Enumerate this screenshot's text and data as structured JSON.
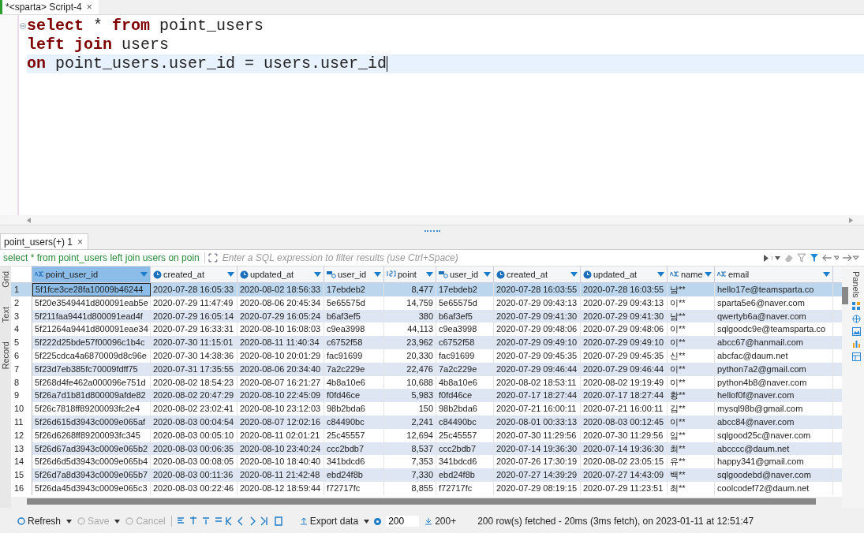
{
  "editor_tab": {
    "title": "*<sparta> Script-4",
    "close": "×"
  },
  "editor": {
    "lines": [
      {
        "current": false,
        "tokens": [
          {
            "kind": "keyword",
            "text": "select"
          },
          {
            "kind": "plain",
            "text": " * "
          },
          {
            "kind": "keyword",
            "text": "from"
          },
          {
            "kind": "plain",
            "text": " point_users"
          }
        ]
      },
      {
        "current": false,
        "tokens": [
          {
            "kind": "keyword",
            "text": "left"
          },
          {
            "kind": "keyword",
            "text": " join"
          },
          {
            "kind": "plain",
            "text": " users"
          }
        ]
      },
      {
        "current": true,
        "tokens": [
          {
            "kind": "keyword",
            "text": "on"
          },
          {
            "kind": "plain",
            "text": " point_users.user_id = users.user_id"
          }
        ]
      }
    ]
  },
  "results_tab": {
    "title": "point_users(+) 1",
    "close": "×"
  },
  "filter": {
    "query": "select * from point_users left join users on poin",
    "placeholder": "Enter a SQL expression to filter results (use Ctrl+Space)"
  },
  "side_tabs": [
    "Grid",
    "Text",
    "Record"
  ],
  "right_panel": {
    "label": "Panels"
  },
  "table": {
    "columns": [
      {
        "label": "point_user_id",
        "kind": "text",
        "selected": true
      },
      {
        "label": "created_at",
        "kind": "date",
        "selected": false
      },
      {
        "label": "updated_at",
        "kind": "date",
        "selected": false
      },
      {
        "label": "user_id",
        "kind": "key",
        "selected": false
      },
      {
        "label": "point",
        "kind": "number",
        "selected": false
      },
      {
        "label": "user_id",
        "kind": "key",
        "selected": false
      },
      {
        "label": "created_at",
        "kind": "date",
        "selected": false
      },
      {
        "label": "updated_at",
        "kind": "date",
        "selected": false
      },
      {
        "label": "name",
        "kind": "text",
        "selected": false
      },
      {
        "label": "email",
        "kind": "text",
        "selected": false
      }
    ],
    "rows": [
      {
        "number": "1",
        "selected": true,
        "cells": [
          "5f1fce3ce28fa10009b46244",
          "2020-07-28 16:05:33",
          "2020-08-02 18:56:33",
          "17ebdeb2",
          "8,477",
          "17ebdeb2",
          "2020-07-28 16:03:55",
          "2020-07-28 16:03:55",
          "남**",
          "hello17e@teamsparta.co"
        ]
      },
      {
        "number": "2",
        "selected": false,
        "cells": [
          "5f20e3549441d800091eab5e",
          "2020-07-29 11:47:49",
          "2020-08-06 20:45:34",
          "5e65575d",
          "14,759",
          "5e65575d",
          "2020-07-29 09:43:13",
          "2020-07-29 09:43:13",
          "이**",
          "sparta5e6@naver.com"
        ]
      },
      {
        "number": "3",
        "selected": false,
        "cells": [
          "5f211faa9441d800091ead4f",
          "2020-07-29 16:05:14",
          "2020-07-29 16:05:24",
          "b6af3ef5",
          "380",
          "b6af3ef5",
          "2020-07-29 09:41:30",
          "2020-07-29 09:41:30",
          "남**",
          "qwertyb6a@naver.com"
        ]
      },
      {
        "number": "4",
        "selected": false,
        "cells": [
          "5f21264a9441d800091eae34",
          "2020-07-29 16:33:31",
          "2020-08-10 16:08:03",
          "c9ea3998",
          "44,113",
          "c9ea3998",
          "2020-07-29 09:48:06",
          "2020-07-29 09:48:06",
          "이**",
          "sqlgoodc9e@teamsparta.co"
        ]
      },
      {
        "number": "5",
        "selected": false,
        "cells": [
          "5f222d25bde57f00096c1b4c",
          "2020-07-30 11:15:01",
          "2020-08-11 11:40:34",
          "c6752f58",
          "23,962",
          "c6752f58",
          "2020-07-29 09:49:10",
          "2020-07-29 09:49:10",
          "이**",
          "abcc67@hanmail.com"
        ]
      },
      {
        "number": "6",
        "selected": false,
        "cells": [
          "5f225cdca4a6870009d8c96e",
          "2020-07-30 14:38:36",
          "2020-08-10 20:01:29",
          "fac91699",
          "20,330",
          "fac91699",
          "2020-07-29 09:45:35",
          "2020-07-29 09:45:35",
          "신**",
          "abcfac@daum.net"
        ]
      },
      {
        "number": "7",
        "selected": false,
        "cells": [
          "5f23d7eb385fc70009fdff75",
          "2020-07-31 17:35:55",
          "2020-08-06 20:34:40",
          "7a2c229e",
          "22,476",
          "7a2c229e",
          "2020-07-29 09:46:44",
          "2020-07-29 09:46:44",
          "이**",
          "python7a2@gmail.com"
        ]
      },
      {
        "number": "8",
        "selected": false,
        "cells": [
          "5f268d4fe462a000096e751d",
          "2020-08-02 18:54:23",
          "2020-08-07 16:21:27",
          "4b8a10e6",
          "10,688",
          "4b8a10e6",
          "2020-08-02 18:53:11",
          "2020-08-02 19:19:49",
          "이**",
          "python4b8@naver.com"
        ]
      },
      {
        "number": "9",
        "selected": false,
        "cells": [
          "5f26a7d1b81d800009afde82",
          "2020-08-02 20:47:29",
          "2020-08-10 22:45:09",
          "f0fd46ce",
          "5,983",
          "f0fd46ce",
          "2020-07-17 18:27:44",
          "2020-07-17 18:27:44",
          "황**",
          "hellof0f@naver.com"
        ]
      },
      {
        "number": "10",
        "selected": false,
        "cells": [
          "5f26c7818ff89200093fc2e4",
          "2020-08-02 23:02:41",
          "2020-08-10 23:12:03",
          "98b2bda6",
          "150",
          "98b2bda6",
          "2020-07-21 16:00:11",
          "2020-07-21 16:00:11",
          "김**",
          "mysql98b@gmail.com"
        ]
      },
      {
        "number": "11",
        "selected": false,
        "cells": [
          "5f26d615d3943c0009e065af",
          "2020-08-03 00:04:54",
          "2020-08-07 12:02:16",
          "c84490bc",
          "2,241",
          "c84490bc",
          "2020-08-01 00:33:13",
          "2020-08-03 00:12:45",
          "이**",
          "abcc84@naver.com"
        ]
      },
      {
        "number": "12",
        "selected": false,
        "cells": [
          "5f26d6268ff89200093fc345",
          "2020-08-03 00:05:10",
          "2020-08-11 02:01:21",
          "25c45557",
          "12,694",
          "25c45557",
          "2020-07-30 11:29:56",
          "2020-07-30 11:29:56",
          "임**",
          "sqlgood25c@naver.com"
        ]
      },
      {
        "number": "13",
        "selected": false,
        "cells": [
          "5f26d67ad3943c0009e065b2",
          "2020-08-03 00:06:35",
          "2020-08-10 23:40:24",
          "ccc2bdb7",
          "8,537",
          "ccc2bdb7",
          "2020-07-14 19:36:30",
          "2020-07-14 19:36:30",
          "최**",
          "abcccc@daum.net"
        ]
      },
      {
        "number": "14",
        "selected": false,
        "cells": [
          "5f26d6d5d3943c0009e065b4",
          "2020-08-03 00:08:05",
          "2020-08-10 18:40:40",
          "341bdcd6",
          "7,353",
          "341bdcd6",
          "2020-07-26 17:30:19",
          "2020-08-02 23:05:15",
          "유**",
          "happy341@gmail.com"
        ]
      },
      {
        "number": "15",
        "selected": false,
        "cells": [
          "5f26d7a8d3943c0009e065b7",
          "2020-08-03 00:11:36",
          "2020-08-11 21:42:48",
          "ebd24f8b",
          "7,330",
          "ebd24f8b",
          "2020-07-27 14:39:29",
          "2020-07-27 14:43:09",
          "백**",
          "sqlgoodebd@naver.com"
        ]
      },
      {
        "number": "16",
        "selected": false,
        "cells": [
          "5f26da45d3943c0009e065c3",
          "2020-08-03 00:22:46",
          "2020-08-12 18:59:44",
          "f72717fc",
          "8,855",
          "f72717fc",
          "2020-07-29 08:19:15",
          "2020-07-29 11:23:51",
          "최**",
          "coolcodef72@daum.net"
        ]
      }
    ]
  },
  "toolbar": {
    "buttons": [
      {
        "label": "Refresh",
        "disabled": false
      },
      {
        "label": "Save",
        "disabled": true
      },
      {
        "label": "Cancel",
        "disabled": true
      }
    ],
    "export": "Export data",
    "fetch_size": "200",
    "fetch_all": "200+",
    "status": "200 row(s) fetched - 20ms (3ms fetch), on 2023-01-11 at 12:51:47"
  }
}
